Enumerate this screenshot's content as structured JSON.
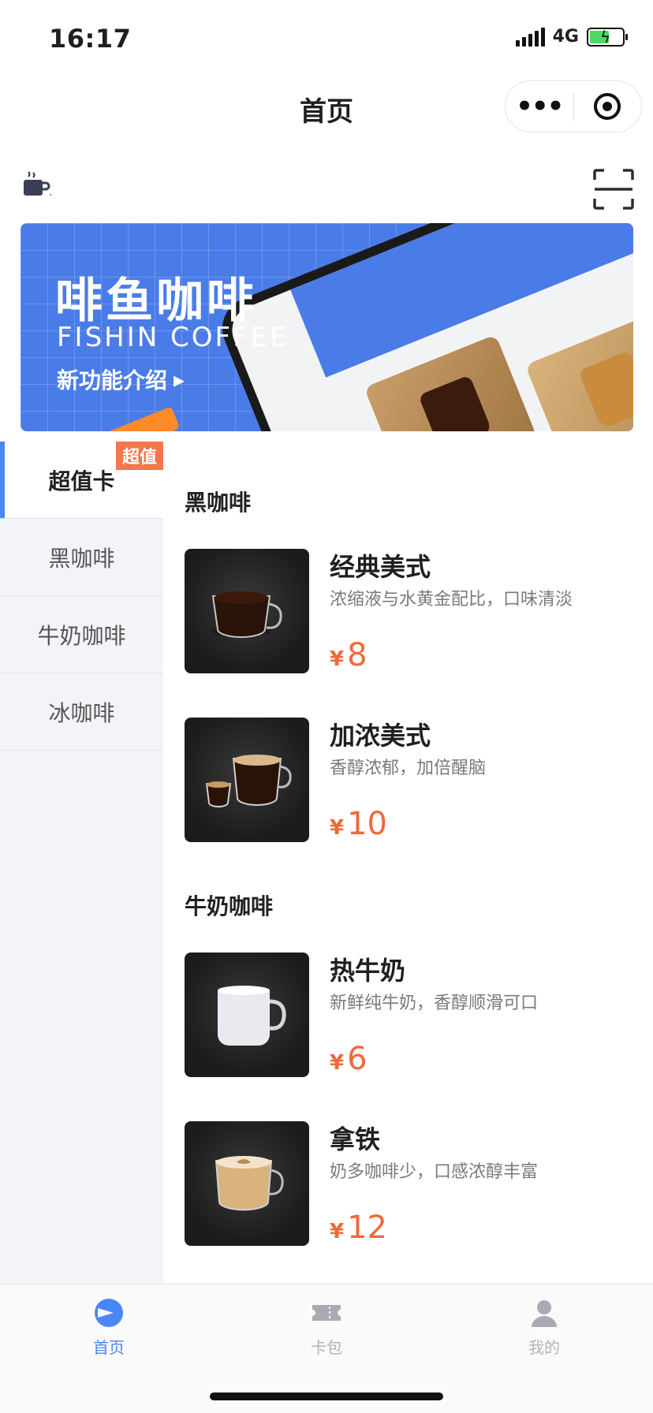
{
  "status": {
    "time": "16:17",
    "network": "4G"
  },
  "nav": {
    "title": "首页",
    "more_icon": "more-dots-icon",
    "close_icon": "target-icon"
  },
  "toolbar": {
    "left_icon": "mug-icon",
    "right_icon": "scan-icon"
  },
  "banner": {
    "title": "啡鱼咖啡",
    "subtitle": "FISHIN COFFEE",
    "link": "新功能介绍",
    "link_arrow": "▸"
  },
  "sidebar": {
    "items": [
      {
        "label": "超值卡",
        "badge": "超值",
        "active": true
      },
      {
        "label": "黑咖啡"
      },
      {
        "label": "牛奶咖啡"
      },
      {
        "label": "冰咖啡"
      }
    ]
  },
  "sections": [
    {
      "title": "黑咖啡",
      "products": [
        {
          "name": "经典美式",
          "desc": "浓缩液与水黄金配比，口味清淡",
          "currency": "¥",
          "price": "8",
          "image": "black-coffee"
        },
        {
          "name": "加浓美式",
          "desc": "香醇浓郁，加倍醒脑",
          "currency": "¥",
          "price": "10",
          "image": "double-americano"
        }
      ]
    },
    {
      "title": "牛奶咖啡",
      "products": [
        {
          "name": "热牛奶",
          "desc": "新鲜纯牛奶，香醇顺滑可口",
          "currency": "¥",
          "price": "6",
          "image": "milk"
        },
        {
          "name": "拿铁",
          "desc": "奶多咖啡少，口感浓醇丰富",
          "currency": "¥",
          "price": "12",
          "image": "latte"
        }
      ]
    }
  ],
  "tabbar": {
    "items": [
      {
        "label": "首页",
        "icon": "home-play-icon",
        "active": true
      },
      {
        "label": "卡包",
        "icon": "ticket-icon"
      },
      {
        "label": "我的",
        "icon": "user-icon"
      }
    ]
  },
  "colors": {
    "accent": "#4a86f7",
    "price": "#f0693a",
    "banner": "#4a7ce8",
    "badge": "#f2774a"
  }
}
